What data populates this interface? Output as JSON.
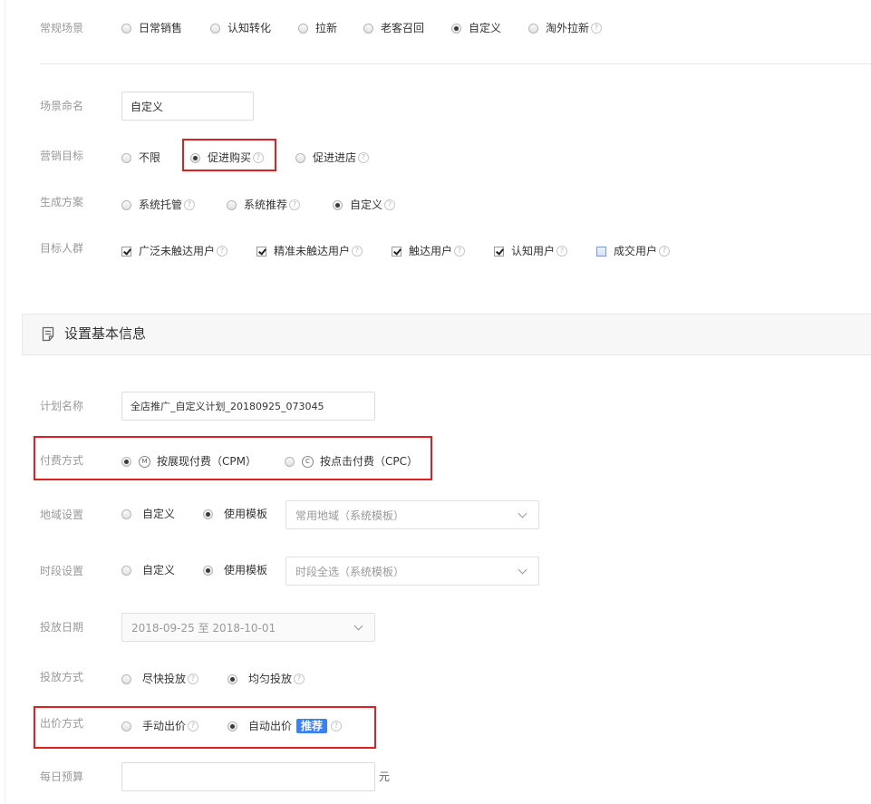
{
  "scene": {
    "label": "常规场景",
    "options": [
      "日常销售",
      "认知转化",
      "拉新",
      "老客召回",
      "自定义",
      "淘外拉新"
    ],
    "selected": "自定义"
  },
  "scene_name": {
    "label": "场景命名",
    "value": "自定义"
  },
  "marketing_goal": {
    "label": "营销目标",
    "options": [
      "不限",
      "促进购买",
      "促进进店"
    ],
    "selected": "促进购买"
  },
  "plan_gen": {
    "label": "生成方案",
    "options": [
      "系统托管",
      "系统推荐",
      "自定义"
    ],
    "selected": "自定义"
  },
  "audience": {
    "label": "目标人群",
    "options": [
      {
        "label": "广泛未触达用户",
        "checked": true
      },
      {
        "label": "精准未触达用户",
        "checked": true
      },
      {
        "label": "触达用户",
        "checked": true
      },
      {
        "label": "认知用户",
        "checked": true
      },
      {
        "label": "成交用户",
        "checked": false
      }
    ]
  },
  "section_title": "设置基本信息",
  "plan_name": {
    "label": "计划名称",
    "value": "全店推广_自定义计划_20180925_073045"
  },
  "payment": {
    "label": "付费方式",
    "options": [
      {
        "icon": "M",
        "label": "按展现付费（CPM）",
        "selected": true
      },
      {
        "icon": "C",
        "label": "按点击付费（CPC）",
        "selected": false
      }
    ]
  },
  "region": {
    "label": "地域设置",
    "options": [
      "自定义",
      "使用模板"
    ],
    "selected": "使用模板",
    "template": "常用地域（系统模板）"
  },
  "time_slot": {
    "label": "时段设置",
    "options": [
      "自定义",
      "使用模板"
    ],
    "selected": "使用模板",
    "template": "时段全选（系统模板）"
  },
  "dates": {
    "label": "投放日期",
    "start": "2018-09-25",
    "separator": "至",
    "end": "2018-10-01"
  },
  "delivery": {
    "label": "投放方式",
    "options": [
      "尽快投放",
      "均匀投放"
    ],
    "selected": "均匀投放"
  },
  "bidding": {
    "label": "出价方式",
    "options": [
      "手动出价",
      "自动出价"
    ],
    "selected": "自动出价",
    "badge": "推荐"
  },
  "budget": {
    "label": "每日预算",
    "value": "",
    "unit": "元"
  },
  "help_glyph": "?",
  "colors": {
    "highlight": "#e02020",
    "badge": "#3d7ff5",
    "label": "#999999"
  }
}
